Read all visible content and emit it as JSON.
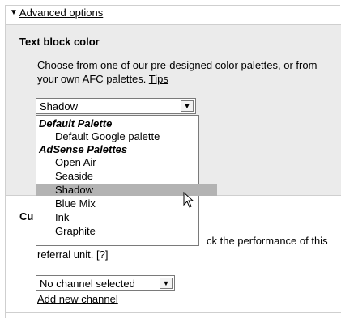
{
  "advanced": {
    "toggle_icon": "triangle-down-icon",
    "label": "Advanced options"
  },
  "text_block": {
    "title": "Text block color",
    "description": "Choose from one of our pre-designed color palettes, or from your own AFC palettes.",
    "tips_link": "Tips",
    "selected": "Shadow"
  },
  "dropdown": {
    "groups": [
      {
        "label": "Default Palette",
        "options": [
          "Default Google palette"
        ]
      },
      {
        "label": "AdSense Palettes",
        "options": [
          "Open Air",
          "Seaside",
          "Shadow",
          "Blue Mix",
          "Ink",
          "Graphite"
        ]
      }
    ],
    "highlighted": "Shadow"
  },
  "channel": {
    "title_fragment": "Cu",
    "track_text": "ck the performance of this",
    "referral_text": "referral unit. [?]",
    "selected": "No channel selected",
    "add_link": "Add new channel"
  },
  "colors": {
    "panel_gray": "#ebebeb",
    "highlight": "#b3b3b3",
    "border": "#7a7a7a"
  }
}
